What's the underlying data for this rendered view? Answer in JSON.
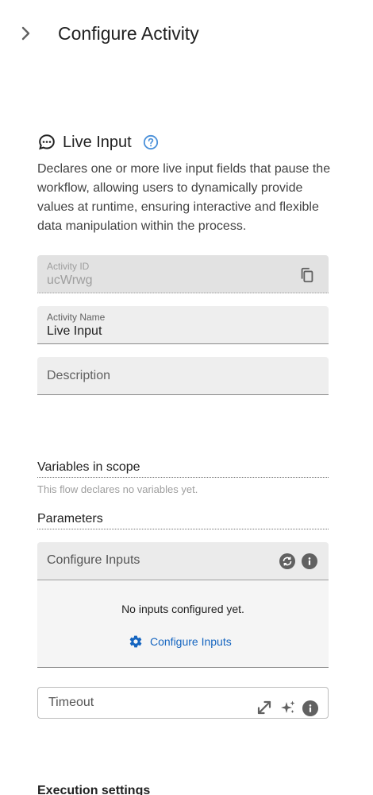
{
  "header": {
    "title": "Configure Activity",
    "collapse_icon": "chevron-right-icon"
  },
  "activity": {
    "icon": "chat-bubble-icon",
    "title": "Live Input",
    "help_icon": "help-circle-icon",
    "description": "Declares one or more live input fields that pause the workflow, allowing users to dynamically provide values at runtime, ensuring interactive and flexible data manipulation within the process."
  },
  "fields": {
    "activity_id": {
      "label": "Activity ID",
      "value": "ucWrwg",
      "icon": "copy-icon"
    },
    "activity_name": {
      "label": "Activity Name",
      "value": "Live Input"
    },
    "description": {
      "placeholder": "Description"
    }
  },
  "variables": {
    "title": "Variables in scope",
    "empty_text": "This flow declares no variables yet."
  },
  "parameters": {
    "title": "Parameters",
    "configure_inputs": {
      "header": "Configure Inputs",
      "empty_text": "No inputs configured yet.",
      "action_label": "Configure Inputs",
      "icons": [
        "sync-icon",
        "info-icon",
        "gear-icon"
      ]
    },
    "timeout": {
      "label": "Timeout",
      "icons": [
        "expand-icon",
        "sparkle-icon",
        "info-icon"
      ]
    }
  },
  "execution": {
    "title": "Execution settings"
  },
  "colors": {
    "accent": "#1565c0",
    "help": "#4a90d9",
    "field_bg": "#eeeeee",
    "icon_gray": "#616161"
  }
}
